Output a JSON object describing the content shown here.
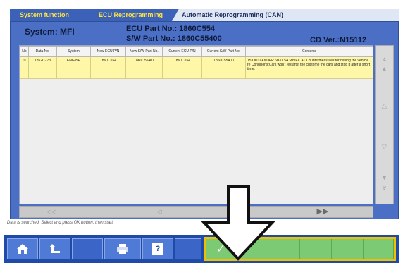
{
  "tabs": [
    "System function",
    "ECU Reprogramming",
    "Automatic Reprogramming (CAN)"
  ],
  "header": {
    "system": "System: MFI",
    "ecu_part": "ECU Part No.: 1860C554",
    "sw_part": "S/W Part No.: 1860C55400",
    "cd_ver": "CD Ver.:N15112"
  },
  "table": {
    "columns": [
      "No",
      "Data No.",
      "System",
      "New ECU P/N",
      "New S/W Part No.",
      "Current ECU P/N",
      "Current S/W Part No.",
      "Contents"
    ],
    "rows": [
      {
        "no": "01",
        "data_no": "1852C273",
        "system": "ENGINE",
        "new_ecu": "1860C554",
        "new_sw": "1860C55401",
        "current_ecu": "1860C554",
        "current_sw": "1860C55400",
        "contents": "15 OUTLANDER 6B31 5A MIVEC AT Countermeasures for having the vehicle re Conditions:Cars won't restart if the custome the cars and stop it after a short time."
      }
    ]
  },
  "scroll": {
    "top": "⩓",
    "page_up": "▲",
    "up": "△",
    "down": "▽",
    "page_down": "▼",
    "bottom": "⩔"
  },
  "paging": {
    "first": "◁◁",
    "prev": "◁",
    "next": "▶▶"
  },
  "status": "Data is searched. Select and press OK button, then start.",
  "toolbar": {
    "home": "home",
    "back": "back",
    "print": "print",
    "help": "?",
    "ok": "✓"
  },
  "colors": {
    "panel": "#4a6fc4",
    "row_selected": "#fff7a8",
    "ok_zone": "#f2bf00",
    "ok_button": "#7ccb74"
  }
}
